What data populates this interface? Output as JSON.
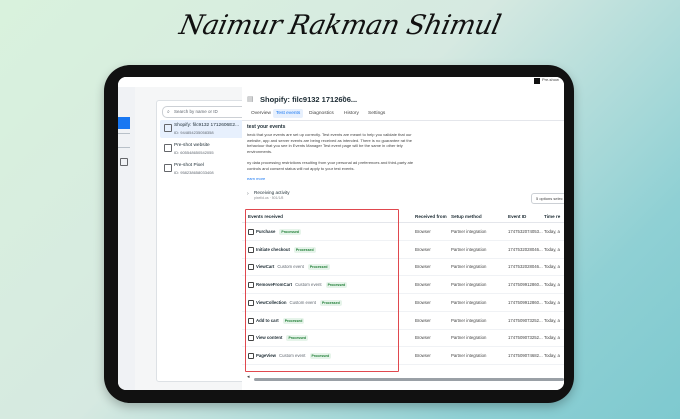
{
  "signature": "Naimur Rakman Shimul",
  "topbar": {
    "label": "Pre-show"
  },
  "search": {
    "placeholder": "Search by name or ID"
  },
  "datasets": [
    {
      "name": "Shopify: filc9132 1712606E2...",
      "id": "ID: 944854235058358"
    },
    {
      "name": "Pre-shot website",
      "id": "ID: 605548650542055"
    },
    {
      "name": "Pre-shot Pixel",
      "id": "ID: 958238658033408"
    }
  ],
  "main": {
    "title": "Shopify: filc9132 1712606...",
    "tabs": [
      "Overview",
      "Test events",
      "Diagnostics",
      "History",
      "Settings"
    ],
    "active_tab": "Test events",
    "section_title": "test your events",
    "para1": "heck that your events are set up correctly. Test events are meant to help you validate that our website, app and server events are being received as intended. There is no guarantee rat the behaviour that you see in Events Manager Test event page will be the same in other tely environments.",
    "para2": "ny data processing restrictions resulting from your personal ad preferences and third-party ate controls and consent status will not apply to your test events.",
    "learn_more": "earn more",
    "receiving": {
      "label": "Receiving activity",
      "sub": "pixelid.us  ·  501/1/8"
    },
    "options": "5 options selec"
  },
  "table": {
    "columns": [
      "Events received",
      "Received from",
      "Setup method",
      "Event ID",
      "Time re"
    ],
    "rows": [
      {
        "name": "Purchase",
        "custom": "",
        "badge": "Processed",
        "from": "Browser",
        "method": "Partner integration",
        "event_id": "1747532074053...",
        "time": "Today, a"
      },
      {
        "name": "Initiate checkout",
        "custom": "",
        "badge": "Processed",
        "from": "Browser",
        "method": "Partner integration",
        "event_id": "1747532028046...",
        "time": "Today, a"
      },
      {
        "name": "ViewCart",
        "custom": "Custom event",
        "badge": "Processed",
        "from": "Browser",
        "method": "Partner integration",
        "event_id": "1747532028046...",
        "time": "Today, a"
      },
      {
        "name": "RemoveFromCart",
        "custom": "Custom event",
        "badge": "Processed",
        "from": "Browser",
        "method": "Partner integration",
        "event_id": "1747509912860...",
        "time": "Today, a"
      },
      {
        "name": "ViewCollection",
        "custom": "Custom event",
        "badge": "Processed",
        "from": "Browser",
        "method": "Partner integration",
        "event_id": "1747509912860...",
        "time": "Today, a"
      },
      {
        "name": "Add to cart",
        "custom": "",
        "badge": "Processed",
        "from": "Browser",
        "method": "Partner integration",
        "event_id": "1747509073252...",
        "time": "Today, a"
      },
      {
        "name": "View content",
        "custom": "",
        "badge": "Processed",
        "from": "Browser",
        "method": "Partner integration",
        "event_id": "1747509073252...",
        "time": "Today, a"
      },
      {
        "name": "PageView",
        "custom": "Custom event",
        "badge": "Processed",
        "from": "Browser",
        "method": "Partner integration",
        "event_id": "1747509074682...",
        "time": "Today, a"
      }
    ]
  },
  "colors": {
    "accent": "#1877f2",
    "highlight": "#e0484e",
    "processed": "#1e7d34"
  }
}
